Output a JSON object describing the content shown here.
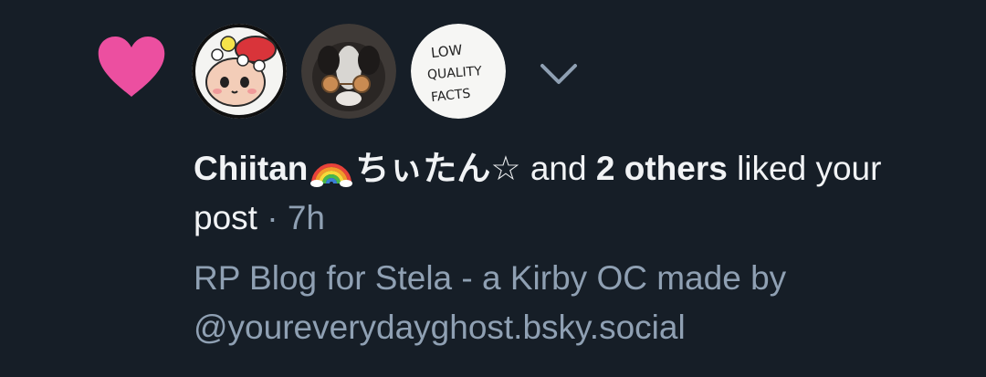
{
  "notification": {
    "icon": "heart-icon",
    "heart_color": "#ec4fa0",
    "avatars": [
      {
        "name": "avatar-chiitan",
        "alt": "cartoon character avatar"
      },
      {
        "name": "avatar-cat",
        "alt": "cat with sunglasses avatar"
      },
      {
        "name": "avatar-low-quality-facts",
        "lines": [
          "LOW",
          "QUALITY",
          "FACTS"
        ]
      }
    ],
    "expand_icon": "chevron-down-icon",
    "actor_name": "Chiitan",
    "actor_name_suffix": "ちぃたん☆",
    "joiner": "and",
    "others": "2 others",
    "action": "liked your post",
    "separator": "·",
    "time": "7h",
    "post_preview_line1": "RP Blog for Stela - a Kirby OC made by",
    "post_preview_line2": "@youreverydayghost.bsky.social"
  },
  "colors": {
    "background": "#161e27",
    "primary_text": "#f1f3f5",
    "secondary_text": "#8fa0b3"
  }
}
